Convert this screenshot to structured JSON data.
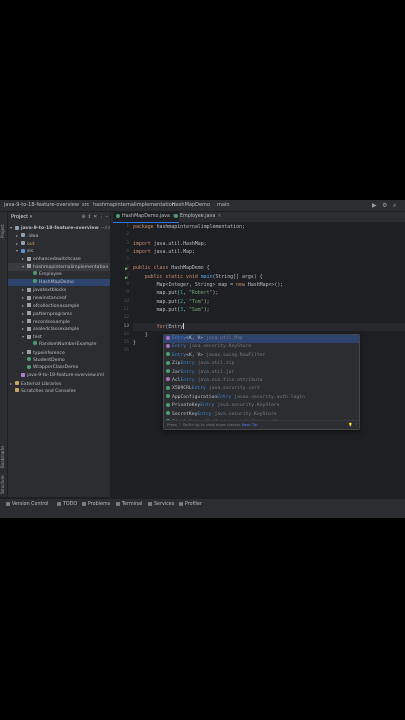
{
  "navbar": {
    "project": "java-9-to-18-feature-overview",
    "folder": "src",
    "package": "hashmapinternalimplementation",
    "class": "HashMapDemo",
    "method": "main"
  },
  "stripe": {
    "project": "Project",
    "bookmarks": "Bookmarks",
    "structure": "Structure"
  },
  "project_panel": {
    "title": "Project",
    "tree": [
      {
        "label": "java-9-to-18-feature-overview",
        "suffix": "~/IdeaProj",
        "icon": "folder",
        "indent": 0,
        "arrow": "▾",
        "bold": true
      },
      {
        "label": ".idea",
        "icon": "folder",
        "indent": 1,
        "arrow": "▸"
      },
      {
        "label": "out",
        "icon": "folder",
        "indent": 1,
        "arrow": "▸",
        "color": "#d69d5e"
      },
      {
        "label": "src",
        "icon": "src",
        "indent": 1,
        "arrow": "▾"
      },
      {
        "label": "enhancedswitchcase",
        "icon": "pkg",
        "indent": 2,
        "arrow": "▸"
      },
      {
        "label": "hashmapinternalimplementation",
        "icon": "pkg",
        "indent": 2,
        "arrow": "▾"
      },
      {
        "label": "Employee",
        "icon": "cls",
        "indent": 3,
        "arrow": ""
      },
      {
        "label": "HashMapDemo",
        "icon": "cls",
        "indent": 3,
        "arrow": "",
        "selected": true
      },
      {
        "label": "javatextblocks",
        "icon": "pkg",
        "indent": 2,
        "arrow": "▸"
      },
      {
        "label": "newinstanceof",
        "icon": "pkg",
        "indent": 2,
        "arrow": "▸"
      },
      {
        "label": "ofcollectionexample",
        "icon": "pkg",
        "indent": 2,
        "arrow": "▸"
      },
      {
        "label": "patternprograms",
        "icon": "pkg",
        "indent": 2,
        "arrow": "▸"
      },
      {
        "label": "recordsexample",
        "icon": "pkg",
        "indent": 2,
        "arrow": "▸"
      },
      {
        "label": "sealedclassexample",
        "icon": "pkg",
        "indent": 2,
        "arrow": "▸"
      },
      {
        "label": "test",
        "icon": "pkg",
        "indent": 2,
        "arrow": "▾"
      },
      {
        "label": "RandomNumberExample",
        "icon": "cls",
        "indent": 3,
        "arrow": ""
      },
      {
        "label": "typeinference",
        "icon": "pkg",
        "indent": 2,
        "arrow": "▸"
      },
      {
        "label": "StudentDemo",
        "icon": "cls",
        "indent": 2,
        "arrow": ""
      },
      {
        "label": "WrapperClassDemo",
        "icon": "cls",
        "indent": 2,
        "arrow": ""
      },
      {
        "label": "java-9-to-18-feature-overview.iml",
        "icon": "file",
        "indent": 1,
        "arrow": ""
      },
      {
        "label": "External Libraries",
        "icon": "lib",
        "indent": 0,
        "arrow": "▸"
      },
      {
        "label": "Scratches and Consoles",
        "icon": "lib",
        "indent": 0,
        "arrow": ""
      }
    ]
  },
  "tabs": [
    {
      "label": "HashMapDemo.java",
      "active": true
    },
    {
      "label": "Employee.java",
      "active": false
    }
  ],
  "code": {
    "line_numbers": [
      "1",
      "2",
      "3",
      "4",
      "5",
      "6",
      "7",
      "8",
      "9",
      "10",
      "11",
      "12",
      "13",
      "14",
      "15",
      "16"
    ],
    "package_kw": "package",
    "package_name": "hashmapinternalimplementation;",
    "import_kw": "import",
    "import1": "java.util.HashMap;",
    "import2": "java.util.Map;",
    "class_decl_kw": "public class",
    "class_name": "HashMapDemo {",
    "main_mods": "public static void",
    "main_name": "main",
    "main_params": "(String[] args) {",
    "map_type": "Map<Integer, String>",
    "map_var": "map",
    "map_eq": "=",
    "new_kw": "new",
    "map_ctor": "HashMap<>();",
    "put1_call": "map.put(",
    "put1_key": "1",
    "put1_val": "\"Robert\"",
    "put1_end": ");",
    "put2_call": "map.put(",
    "put2_key": "2",
    "put2_val": "\"Tom\"",
    "put2_end": ");",
    "put3_call": "map.put(",
    "put3_key": "3",
    "put3_val": "\"Sam\"",
    "put3_end": ");",
    "for_kw": "for",
    "for_rest": "(Entry",
    "close_method": "}",
    "close_class": "}"
  },
  "completion": {
    "items": [
      {
        "name": "Entry",
        "extra": "<K, V>",
        "pkg": "java.util.Map",
        "icon": "intf",
        "selected": true
      },
      {
        "name": "Entry",
        "extra": "",
        "pkg": "java.security.KeyStore",
        "icon": "intf"
      },
      {
        "name": "Entry",
        "extra": "<K, V>",
        "pkg": "javax.swing.RowFilter",
        "icon": "cls"
      },
      {
        "name": "Zip",
        "match": "Entry",
        "pkg": "java.util.zip",
        "icon": "cls"
      },
      {
        "name": "Jar",
        "match": "Entry",
        "pkg": "java.util.jar",
        "icon": "cls"
      },
      {
        "name": "Acl",
        "match": "Entry",
        "pkg": "java.nio.file.attribute",
        "icon": "intf"
      },
      {
        "name": "X509CRL",
        "match": "Entry",
        "pkg": "java.security.cert",
        "icon": "cls"
      },
      {
        "name": "AppConfiguration",
        "match": "Entry",
        "pkg": "javax.security.auth.login",
        "icon": "cls"
      },
      {
        "name": "PrivateKey",
        "match": "Entry",
        "pkg": "java.security.KeyStore",
        "icon": "cls"
      },
      {
        "name": "SecretKey",
        "match": "Entry",
        "pkg": "java.security.KeyStore",
        "icon": "cls"
      },
      {
        "name": "Simple",
        "match": "Entry",
        "extra": "<K, V>",
        "pkg": "java.util.AbstractMap",
        "icon": "cls"
      }
    ],
    "footer": "Press ^ Shift+Up to view more classes",
    "footer_link": "Next Tip"
  },
  "bottombar": {
    "items": [
      "Version Control",
      "TODO",
      "Problems",
      "Terminal",
      "Services",
      "Profiler"
    ]
  }
}
